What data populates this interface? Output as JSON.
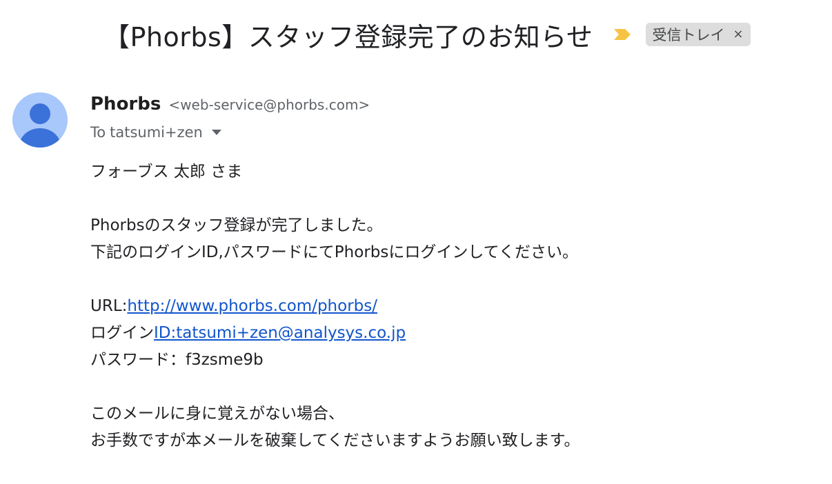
{
  "email": {
    "subject": "【Phorbs】スタッフ登録完了のお知らせ",
    "label": "受信トレイ",
    "label_close": "×",
    "importance_icon": "importance-marker-icon",
    "colors": {
      "importance": "#f6c343",
      "link": "#1155cc",
      "avatar_bg": "#a8c7fa",
      "avatar_fg": "#3b72d9"
    },
    "sender": {
      "name": "Phorbs",
      "email": "<web-service@phorbs.com>"
    },
    "recipients": {
      "to_label": "To",
      "value": "tatsumi+zen"
    },
    "body": {
      "greeting": "フォーブス 太郎 さま",
      "line1": "Phorbsのスタッフ登録が完了しました。",
      "line2": "下記のログインID,パスワードにてPhorbsにログインしてください。",
      "url_label": "URL:",
      "url": "http://www.phorbs.com/phorbs/",
      "login_label": "ログイン",
      "login_id": "ID:tatsumi+zen@analysys.co.jp",
      "password_line": "パスワード：f3zsme9b",
      "closing1": "このメールに身に覚えがない場合、",
      "closing2": "お手数ですが本メールを破棄してくださいますようお願い致します。"
    }
  }
}
